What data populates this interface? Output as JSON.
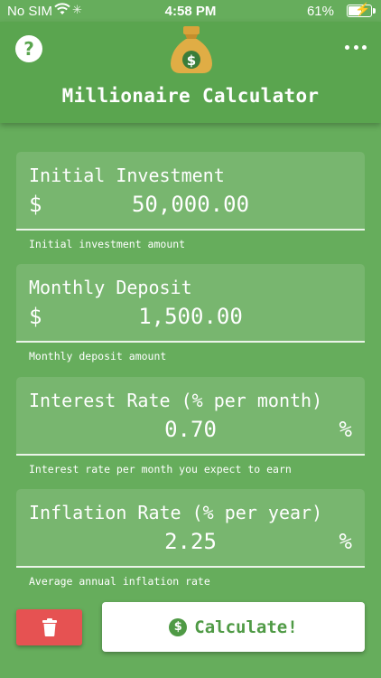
{
  "status_bar": {
    "carrier": "No SIM",
    "time": "4:58 PM",
    "battery": "61%",
    "battery_level": 0.61
  },
  "header": {
    "title": "Millionaire Calculator",
    "help_icon": "question-circle-icon",
    "menu_icon": "more-dots-icon",
    "logo_icon": "money-bag-icon",
    "help_glyph": "?"
  },
  "fields": {
    "initial": {
      "label": "Initial Investment",
      "prefix": "$",
      "value": "50,000.00",
      "helper": "Initial investment amount"
    },
    "monthly": {
      "label": "Monthly Deposit",
      "prefix": "$",
      "value": "1,500.00",
      "helper": "Monthly deposit amount"
    },
    "interest": {
      "label": "Interest Rate (% per month)",
      "suffix": "%",
      "value": "0.70",
      "helper": "Interest rate per month you expect to earn"
    },
    "inflation": {
      "label": "Inflation Rate (% per year)",
      "suffix": "%",
      "value": "2.25",
      "helper": "Average annual inflation rate"
    }
  },
  "actions": {
    "calculate_label": "Calculate!",
    "calculate_icon": "dollar-circle-icon",
    "calculate_glyph": "$",
    "delete_icon": "trash-icon"
  },
  "colors": {
    "background": "#66ad5c",
    "header": "#5aa54f",
    "delete": "#e65252",
    "accent": "#4f9a45"
  }
}
